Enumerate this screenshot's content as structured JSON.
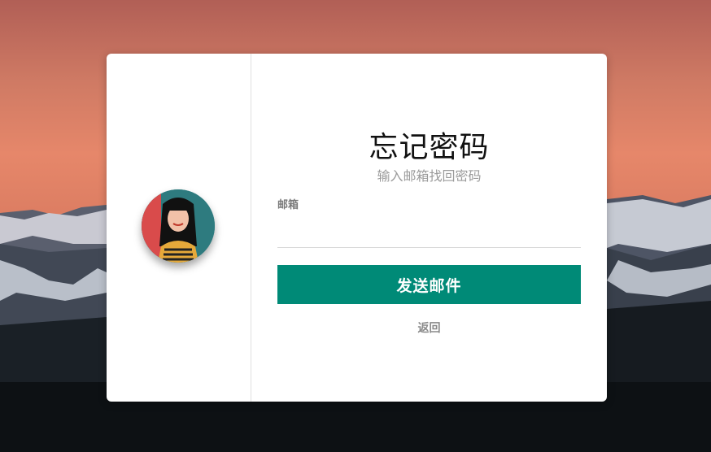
{
  "form": {
    "title": "忘记密码",
    "subtitle": "输入邮箱找回密码",
    "email_label": "邮箱",
    "email_value": "",
    "submit_label": "发送邮件",
    "back_label": "返回"
  },
  "colors": {
    "accent": "#008a77",
    "card": "#ffffff"
  },
  "icons": [
    "avatar-illustration"
  ]
}
